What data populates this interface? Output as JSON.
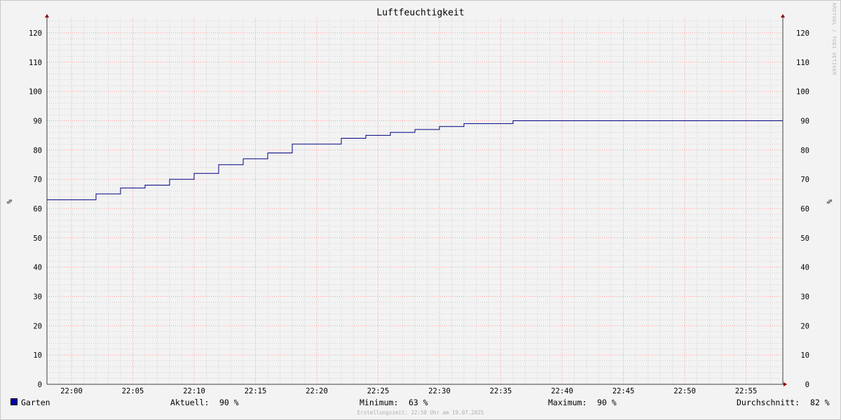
{
  "title": "Luftfeuchtigkeit",
  "watermark": "RRDTOOL / TOBI OETIKER",
  "footer": "Erstellungszeit: 22:58 Uhr am 19.07.2025",
  "colors": {
    "series": "#000080",
    "legend_swatch": "#0000a8",
    "major_grid": "#ff9999",
    "minor_grid": "#d0d0d0",
    "axis": "#404040",
    "arrow": "#880000"
  },
  "legend": {
    "series_name": "Garten",
    "current_label": "Aktuell:",
    "current_value": "90 %",
    "min_label": "Minimum:",
    "min_value": "63 %",
    "max_label": "Maximum:",
    "max_value": "90 %",
    "avg_label": "Durchschnitt:",
    "avg_value": "82 %"
  },
  "chart_data": {
    "type": "line",
    "title": "Luftfeuchtigkeit",
    "ylabel": "%",
    "ylabel_right": "%",
    "xlabel": "",
    "ylim": [
      0,
      125
    ],
    "xlim": [
      "21:58",
      "22:58"
    ],
    "grid": true,
    "y_ticks": [
      0,
      10,
      20,
      30,
      40,
      50,
      60,
      70,
      80,
      90,
      100,
      110,
      120
    ],
    "x_ticks": [
      "22:00",
      "22:05",
      "22:10",
      "22:15",
      "22:20",
      "22:25",
      "22:30",
      "22:35",
      "22:40",
      "22:45",
      "22:50",
      "22:55"
    ],
    "series": [
      {
        "name": "Garten",
        "step": true,
        "x": [
          "21:58",
          "22:02",
          "22:04",
          "22:06",
          "22:08",
          "22:10",
          "22:12",
          "22:14",
          "22:16",
          "22:18",
          "22:22",
          "22:24",
          "22:26",
          "22:28",
          "22:30",
          "22:32",
          "22:36",
          "22:58"
        ],
        "y": [
          63,
          65,
          67,
          68,
          70,
          72,
          75,
          77,
          79,
          82,
          84,
          85,
          86,
          87,
          88,
          89,
          90,
          90
        ]
      }
    ]
  }
}
